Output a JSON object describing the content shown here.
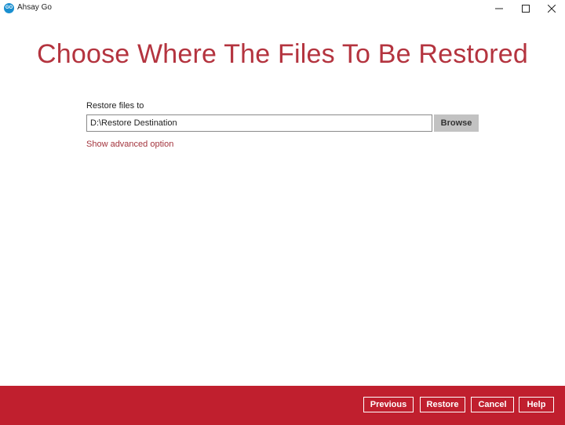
{
  "titlebar": {
    "app_icon_text": "GO",
    "app_name": "Ahsay Go",
    "icons": [
      "minimize-icon",
      "maximize-icon",
      "close-icon"
    ]
  },
  "main": {
    "title": "Choose Where The Files To Be Restored",
    "restore_label": "Restore files to",
    "restore_path": "D:\\Restore Destination",
    "browse_label": "Browse",
    "advanced_link": "Show advanced option"
  },
  "footer": {
    "previous_label": "Previous",
    "restore_label": "Restore",
    "cancel_label": "Cancel",
    "help_label": "Help"
  },
  "colors": {
    "accent": "#c01f2e",
    "title_text": "#b4343f",
    "link_text": "#a3343d",
    "browse_button": "#c2c2c2"
  }
}
